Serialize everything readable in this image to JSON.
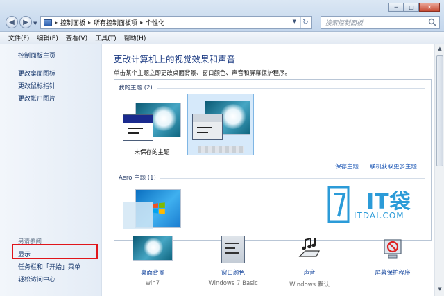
{
  "window": {
    "minimize": "─",
    "maximize": "□",
    "close": "✕"
  },
  "address": {
    "crumbs": [
      "控制面板",
      "所有控制面板项",
      "个性化"
    ],
    "separator": "▸"
  },
  "search": {
    "placeholder": "搜索控制面板"
  },
  "menu": [
    "文件(F)",
    "编辑(E)",
    "查看(V)",
    "工具(T)",
    "帮助(H)"
  ],
  "sidebar": {
    "links": [
      "控制面板主页",
      "更改桌面图标",
      "更改鼠标指针",
      "更改帐户图片"
    ],
    "see_also_title": "另请参阅",
    "see_also": [
      "显示",
      "任务栏和「开始」菜单",
      "轻松访问中心"
    ]
  },
  "main": {
    "title": "更改计算机上的视觉效果和声音",
    "subtitle": "单击某个主题立即更改桌面背景、窗口颜色、声音和屏幕保护程序。",
    "my_themes_header": "我的主题 (2)",
    "unsaved_theme": "未保存的主题",
    "save_theme": "保存主题",
    "get_more_themes": "联机获取更多主题",
    "aero_header": "Aero 主题 (1)"
  },
  "bottom": [
    {
      "label": "桌面背景",
      "value": "win7",
      "icon": "desktop-background-icon"
    },
    {
      "label": "窗口颜色",
      "value": "Windows 7 Basic",
      "icon": "window-color-icon"
    },
    {
      "label": "声音",
      "value": "Windows 默认",
      "icon": "sound-icon"
    },
    {
      "label": "屏幕保护程序",
      "value": "",
      "icon": "screensaver-icon"
    }
  ],
  "watermark": {
    "big": "IT袋",
    "small": "ITDAI.COM"
  },
  "colors": {
    "accent": "#1e3d84",
    "highlight": "#e0151b",
    "link": "#1a55b4",
    "logo": "#2b9bd8"
  }
}
